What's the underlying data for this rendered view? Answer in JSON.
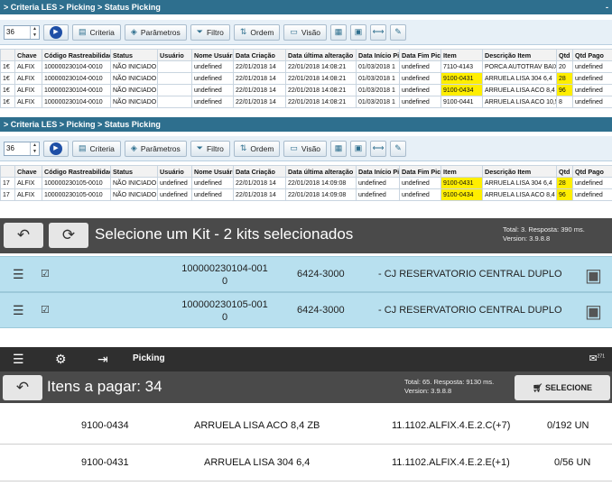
{
  "panels": [
    {
      "breadcrumb": "> Criteria LES > Picking > Status Picking",
      "collapse": "-",
      "page_size": "36",
      "toolbar": {
        "criteria": "Criteria",
        "parametros": "Parâmetros",
        "filtro": "Filtro",
        "ordem": "Ordem",
        "visao": "Visão"
      },
      "columns": [
        "Chave",
        "Código Rastreabilidade",
        "Status",
        "Usuário",
        "Nome Usuário",
        "Data Criação",
        "Data última alteração",
        "Data Início Picking",
        "Data Fim Picking",
        "Item",
        "Descrição Item",
        "Qtd",
        "Qtd Pago"
      ],
      "rows": [
        [
          "1€",
          "ALFIX",
          "100000230104-0010",
          "NÃO INICIADO",
          "",
          "undefined",
          "22/01/2018 14",
          "22/01/2018 14:08:21",
          "01/03/2018 1",
          "undefined",
          "7110-4143",
          "PORCA AUTOTRAV BAIX",
          "20",
          "undefined"
        ],
        [
          "1€",
          "ALFIX",
          "100000230104-0010",
          "NÃO INICIADO",
          "",
          "undefined",
          "22/01/2018 14",
          "22/01/2018 14:08:21",
          "01/03/2018 1",
          "undefined",
          "9100-0431",
          "ARRUELA LISA 304 6,4",
          "28",
          "undefined"
        ],
        [
          "1€",
          "ALFIX",
          "100000230104-0010",
          "NÃO INICIADO",
          "",
          "undefined",
          "22/01/2018 14",
          "22/01/2018 14:08:21",
          "01/03/2018 1",
          "undefined",
          "9100-0434",
          "ARRUELA LISA ACO 8,4",
          "96",
          "undefined"
        ],
        [
          "1€",
          "ALFIX",
          "100000230104-0010",
          "NÃO INICIADO",
          "",
          "undefined",
          "22/01/2018 14",
          "22/01/2018 14:08:21",
          "01/03/2018 1",
          "undefined",
          "9100-0441",
          "ARRUELA LISA ACO 10,5",
          "8",
          "undefined"
        ]
      ],
      "highlights": [
        [
          1,
          10
        ],
        [
          1,
          12
        ],
        [
          2,
          10
        ],
        [
          2,
          12
        ]
      ]
    },
    {
      "breadcrumb": "> Criteria LES > Picking > Status Picking",
      "collapse": "",
      "page_size": "36",
      "toolbar": {
        "criteria": "Criteria",
        "parametros": "Parâmetros",
        "filtro": "Filtro",
        "ordem": "Ordem",
        "visao": "Visão"
      },
      "columns": [
        "Chave",
        "Código Rastreabilidade",
        "Status",
        "Usuário",
        "Nome Usuário",
        "Data Criação",
        "Data última alteração",
        "Data Início Picking",
        "Data Fim Picking",
        "Item",
        "Descrição Item",
        "Qtd",
        "Qtd Pago"
      ],
      "rows": [
        [
          "17",
          "ALFIX",
          "100000230105-0010",
          "NÃO INICIADO",
          "undefined",
          "undefined",
          "22/01/2018 14",
          "22/01/2018 14:09:08",
          "undefined",
          "undefined",
          "9100-0431",
          "ARRUELA LISA 304 6,4",
          "28",
          "undefined"
        ],
        [
          "17",
          "ALFIX",
          "100000230105-0010",
          "NÃO INICIADO",
          "undefined",
          "undefined",
          "22/01/2018 14",
          "22/01/2018 14:09:08",
          "undefined",
          "undefined",
          "9100-0434",
          "ARRUELA LISA ACO 8,4",
          "96",
          "undefined"
        ]
      ],
      "highlights": [
        [
          0,
          10
        ],
        [
          0,
          12
        ],
        [
          1,
          10
        ],
        [
          1,
          12
        ]
      ]
    }
  ],
  "kit": {
    "title": "Selecione um Kit - 2 kits selecionados",
    "total_line1": "Total: 3. Resposta: 390 ms.",
    "total_line2": "Version: 3.9.8.8",
    "rows": [
      {
        "code_line1": "100000230104-001",
        "code_line2": "0",
        "ref": "6424-3000",
        "desc": "- CJ RESERVATORIO CENTRAL DUPLO"
      },
      {
        "code_line1": "100000230105-001",
        "code_line2": "0",
        "ref": "6424-3000",
        "desc": "- CJ RESERVATORIO CENTRAL DUPLO"
      }
    ]
  },
  "picking": {
    "nav_title": "Picking",
    "badge_count": "271",
    "title": "Itens a pagar: 34",
    "total_line1": "Total: 65. Resposta: 9130 ms.",
    "total_line2": "Version: 3.9.8.8",
    "select_label": "SELECIONE",
    "rows": [
      {
        "code": "9100-0434",
        "desc": "ARRUELA LISA ACO 8,4 ZB",
        "location": "11.1102.ALFIX.4.E.2.C(+7)",
        "qty": "0/192 UN"
      },
      {
        "code": "9100-0431",
        "desc": "ARRUELA LISA 304 6,4",
        "location": "11.1102.ALFIX.4.E.2.E(+1)",
        "qty": "0/56 UN"
      }
    ]
  }
}
